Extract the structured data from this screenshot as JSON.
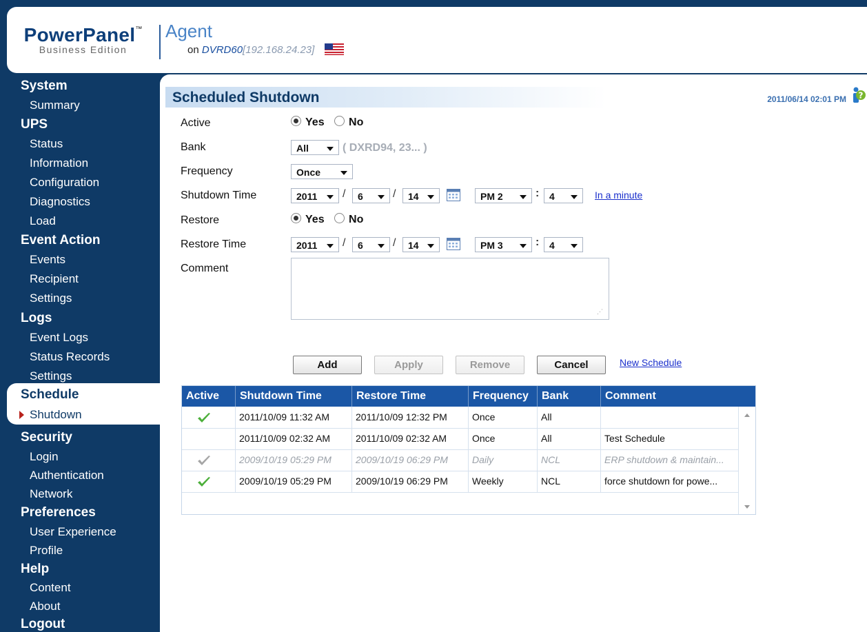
{
  "header": {
    "brand": "PowerPanel",
    "tm": "™",
    "edition": "Business Edition",
    "agent": "Agent",
    "on_label": "on",
    "host": "DVRD60",
    "ip_open": "[",
    "ip": "192.168.24.23",
    "ip_close": "]",
    "flag_icon": "us-flag-icon"
  },
  "sidebar": {
    "categories": [
      {
        "label": "System",
        "items": [
          "Summary"
        ]
      },
      {
        "label": "UPS",
        "items": [
          "Status",
          "Information",
          "Configuration",
          "Diagnostics",
          "Load"
        ]
      },
      {
        "label": "Event Action",
        "items": [
          "Events",
          "Recipient",
          "Settings"
        ]
      },
      {
        "label": "Logs",
        "items": [
          "Event Logs",
          "Status Records",
          "Settings"
        ]
      },
      {
        "label": "Schedule",
        "items": [
          "Shutdown"
        ]
      },
      {
        "label": "Security",
        "items": [
          "Login",
          "Authentication",
          "Network"
        ]
      },
      {
        "label": "Preferences",
        "items": [
          "User Experience",
          "Profile"
        ]
      },
      {
        "label": "Help",
        "items": [
          "Content",
          "About"
        ]
      },
      {
        "label": "Logout",
        "items": []
      }
    ]
  },
  "main": {
    "title": "Scheduled Shutdown",
    "datetime": "2011/06/14 02:01 PM",
    "form": {
      "active_label": "Active",
      "yes": "Yes",
      "no": "No",
      "bank_label": "Bank",
      "bank_value": "All",
      "bank_devices": "( DXRD94, 23... )",
      "frequency_label": "Frequency",
      "frequency_value": "Once",
      "shutdown_time_label": "Shutdown Time",
      "shutdown": {
        "year": "2011",
        "month": "6",
        "day": "14",
        "hour": "PM 2",
        "minute": "4"
      },
      "in_a_minute": "In a minute",
      "restore_label": "Restore",
      "restore_time_label": "Restore Time",
      "restore": {
        "year": "2011",
        "month": "6",
        "day": "14",
        "hour": "PM 3",
        "minute": "4"
      },
      "comment_label": "Comment",
      "comment_value": "",
      "slash": "/",
      "colon": ":"
    },
    "buttons": {
      "add": "Add",
      "apply": "Apply",
      "remove": "Remove",
      "cancel": "Cancel",
      "new_schedule": "New Schedule"
    },
    "table": {
      "headers": [
        "Active",
        "Shutdown Time",
        "Restore  Time",
        "Frequency",
        "Bank",
        "Comment"
      ],
      "rows": [
        {
          "active": "check-green",
          "shutdown": "2011/10/09 11:32 AM",
          "restore": "2011/10/09 12:32 PM",
          "frequency": "Once",
          "bank": "All",
          "comment": ""
        },
        {
          "active": "",
          "shutdown": "2011/10/09 02:32 AM",
          "restore": "2011/10/09 02:32 AM",
          "frequency": "Once",
          "bank": "All",
          "comment": "Test Schedule"
        },
        {
          "active": "check-gray",
          "shutdown": "2009/10/19 05:29 PM",
          "restore": "2009/10/19 06:29 PM",
          "frequency": "Daily",
          "bank": "NCL",
          "comment": "ERP shutdown & maintain..."
        },
        {
          "active": "check-green",
          "shutdown": "2009/10/19 05:29 PM",
          "restore": "2009/10/19 06:29 PM",
          "frequency": "Weekly",
          "bank": "NCL",
          "comment": "force shutdown for powe..."
        }
      ]
    }
  },
  "colors": {
    "nav_bg": "#0f3a66",
    "table_header": "#1b57a6",
    "check_green": "#4caf3a",
    "link": "#1a2fcc"
  }
}
